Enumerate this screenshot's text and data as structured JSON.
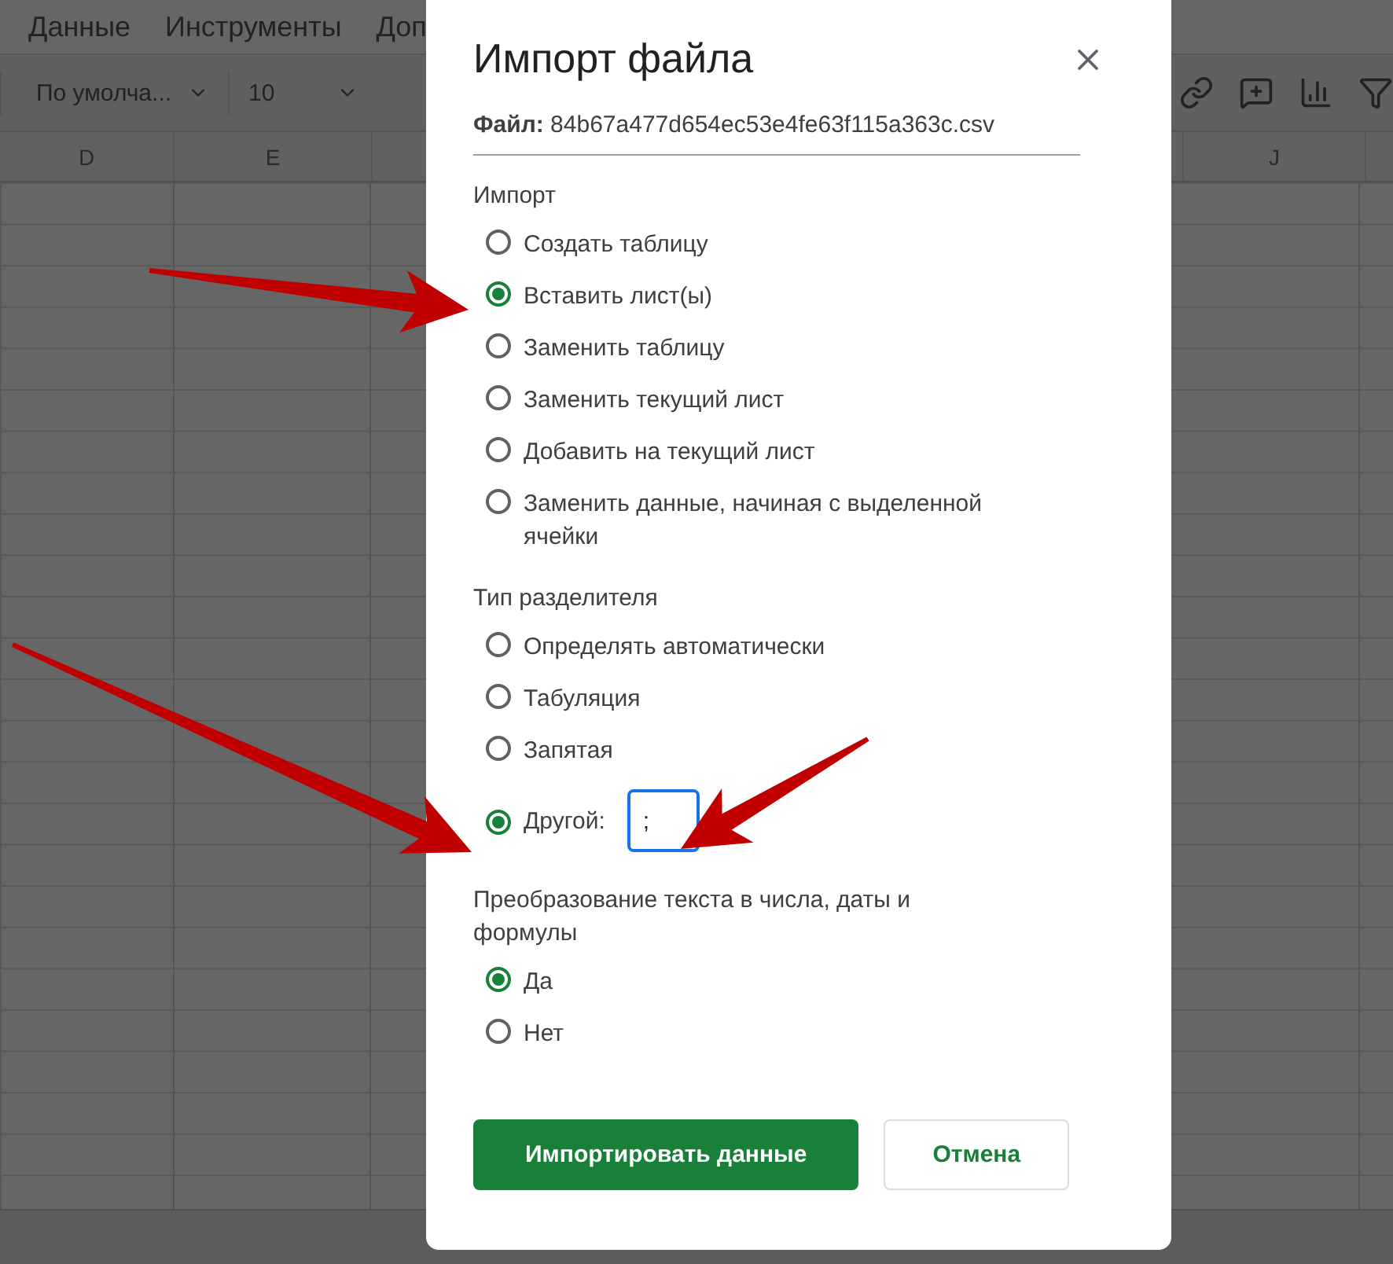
{
  "menu": [
    {
      "label": "Данные"
    },
    {
      "label": "Инструменты"
    },
    {
      "label": "Доп"
    }
  ],
  "toolbar": {
    "font": "По умолча...",
    "size": "10"
  },
  "columns": [
    "D",
    "E",
    "J"
  ],
  "dialog": {
    "title": "Импорт файла",
    "file": "**Файл:** 84b67a477d654ec53e4fe63f115a363c.csv",
    "sections": [
      {
        "title": "Импорт",
        "options": [
          {
            "label": "Создать таблицу",
            "selected": false,
            "kind": "plain"
          },
          {
            "label": "Вставить лист(ы)",
            "selected": true,
            "kind": "plain"
          },
          {
            "label": "Заменить таблицу",
            "selected": false,
            "kind": "plain"
          },
          {
            "label": "Заменить текущий лист",
            "selected": false,
            "kind": "plain"
          },
          {
            "label": "Добавить на текущий лист",
            "selected": false,
            "kind": "plain"
          },
          {
            "label": "Заменить данные, начиная с выделенной ячейки",
            "selected": false,
            "kind": "plain"
          }
        ]
      },
      {
        "title": "Тип разделителя",
        "options": [
          {
            "label": "Определять автоматически",
            "selected": false,
            "kind": "plain"
          },
          {
            "label": "Табуляция",
            "selected": false,
            "kind": "plain"
          },
          {
            "label": "Запятая",
            "selected": false,
            "kind": "plain"
          },
          {
            "label": "Другой:",
            "selected": true,
            "kind": "field",
            "value": ";"
          }
        ]
      },
      {
        "title": "Преобразование текста в числа, даты и формулы",
        "options": [
          {
            "label": "Да",
            "selected": true,
            "kind": "plain"
          },
          {
            "label": "Нет",
            "selected": false,
            "kind": "plain"
          }
        ]
      }
    ],
    "buttons": [
      {
        "label": "Импортировать данные",
        "kind": "primary"
      },
      {
        "label": "Отмена",
        "kind": "secondary"
      }
    ]
  }
}
